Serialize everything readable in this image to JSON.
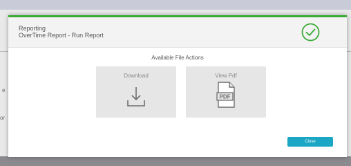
{
  "background": {
    "fragment_left_a": "e",
    "fragment_left_b": "or"
  },
  "modal": {
    "title": "Reporting",
    "subtitle": "OverTime Report - Run Report",
    "status_icon": "check-circle-icon",
    "accent_color": "#3aaa35"
  },
  "file_actions": {
    "heading": "Available File Actions",
    "items": [
      {
        "label": "Download",
        "icon": "download-icon"
      },
      {
        "label": "View Pdf",
        "icon": "pdf-file-icon"
      }
    ]
  },
  "footer": {
    "close_label": "Close",
    "close_color": "#1aa6c4"
  }
}
